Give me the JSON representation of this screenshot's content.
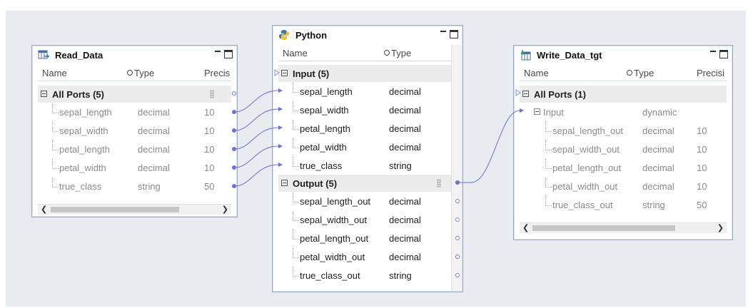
{
  "read_node": {
    "title": "Read_Data",
    "headers": {
      "name": "Name",
      "type": "Type",
      "precision": "Precis"
    },
    "group_label": "All Ports (5)",
    "rows": [
      {
        "name": "sepal_length",
        "type": "decimal",
        "precision": "10"
      },
      {
        "name": "sepal_width",
        "type": "decimal",
        "precision": "10"
      },
      {
        "name": "petal_length",
        "type": "decimal",
        "precision": "10"
      },
      {
        "name": "petal_width",
        "type": "decimal",
        "precision": "10"
      },
      {
        "name": "true_class",
        "type": "string",
        "precision": "50"
      }
    ]
  },
  "python_node": {
    "title": "Python",
    "headers": {
      "name": "Name",
      "type": "Type"
    },
    "input_group": "Input (5)",
    "inputs": [
      {
        "name": "sepal_length",
        "type": "decimal"
      },
      {
        "name": "sepal_width",
        "type": "decimal"
      },
      {
        "name": "petal_length",
        "type": "decimal"
      },
      {
        "name": "petal_width",
        "type": "decimal"
      },
      {
        "name": "true_class",
        "type": "string"
      }
    ],
    "output_group": "Output (5)",
    "outputs": [
      {
        "name": "sepal_length_out",
        "type": "decimal"
      },
      {
        "name": "sepal_width_out",
        "type": "decimal"
      },
      {
        "name": "petal_length_out",
        "type": "decimal"
      },
      {
        "name": "petal_width_out",
        "type": "decimal"
      },
      {
        "name": "true_class_out",
        "type": "string"
      }
    ]
  },
  "write_node": {
    "title": "Write_Data_tgt",
    "headers": {
      "name": "Name",
      "type": "Type",
      "precision": "Precisi"
    },
    "group_label": "All Ports (1)",
    "sub_group": {
      "name": "Input",
      "type": "dynamic"
    },
    "rows": [
      {
        "name": "sepal_length_out",
        "type": "decimal",
        "precision": "10"
      },
      {
        "name": "sepal_width_out",
        "type": "decimal",
        "precision": "10"
      },
      {
        "name": "petal_length_out",
        "type": "decimal",
        "precision": "10"
      },
      {
        "name": "petal_width_out",
        "type": "decimal",
        "precision": "10"
      },
      {
        "name": "true_class_out",
        "type": "string",
        "precision": "50"
      }
    ]
  },
  "icons": {
    "read": "table-read-icon",
    "python": "python-icon",
    "write": "table-write-icon"
  },
  "colors": {
    "canvas": "#e8ecf1",
    "link": "#6a70d8",
    "group_bg": "#ececec",
    "muted_text": "#8c8c8c"
  }
}
